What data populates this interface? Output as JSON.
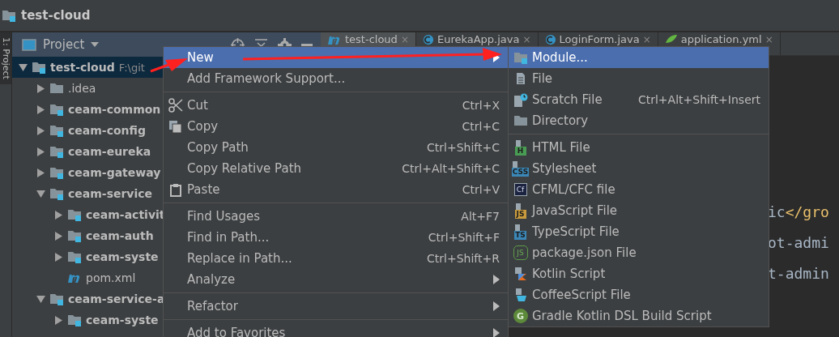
{
  "title": "test-cloud",
  "tool_window_tab": "1: Project",
  "project_panel": {
    "title": "Project"
  },
  "tree": [
    {
      "label": "test-cloud",
      "path": "F:\\git",
      "kind": "module",
      "expanded": true,
      "selected": true,
      "children": [
        {
          "label": ".idea",
          "kind": "folder",
          "expanded": false,
          "selected": false
        },
        {
          "label": "ceam-common",
          "kind": "module",
          "expanded": false,
          "selected": false
        },
        {
          "label": "ceam-config",
          "kind": "module",
          "expanded": false,
          "selected": false
        },
        {
          "label": "ceam-eureka",
          "kind": "module",
          "expanded": false,
          "selected": false
        },
        {
          "label": "ceam-gateway",
          "kind": "module",
          "expanded": false,
          "selected": false
        },
        {
          "label": "ceam-service",
          "kind": "module",
          "expanded": true,
          "selected": false,
          "children": [
            {
              "label": "ceam-activit",
              "kind": "module",
              "expanded": false,
              "selected": false
            },
            {
              "label": "ceam-auth",
              "kind": "module",
              "expanded": false,
              "selected": false
            },
            {
              "label": "ceam-syste",
              "kind": "module",
              "expanded": false,
              "selected": false
            },
            {
              "label": "pom.xml",
              "kind": "maven",
              "selected": false
            }
          ]
        },
        {
          "label": "ceam-service-a",
          "kind": "module",
          "expanded": true,
          "selected": false,
          "children": [
            {
              "label": "ceam-syste",
              "kind": "module",
              "expanded": false,
              "selected": false
            }
          ]
        }
      ]
    }
  ],
  "editor_tabs": [
    {
      "label": "test-cloud",
      "close": "×",
      "kind": "maven",
      "selected": true
    },
    {
      "label": "EurekaApp.java",
      "close": "×",
      "kind": "java",
      "selected": false
    },
    {
      "label": "LoginForm.java",
      "close": "×",
      "kind": "java",
      "selected": false
    },
    {
      "label": "application.yml",
      "close": "×",
      "kind": "yaml",
      "selected": false
    }
  ],
  "code_lines": [
    [
      {
        "text": "ic",
        "kind": "text"
      },
      {
        "text": "</gro",
        "kind": "tag"
      }
    ],
    [
      {
        "text": "ot-admi",
        "kind": "text"
      }
    ],
    [
      {
        "text": "t-admin",
        "kind": "text"
      }
    ]
  ],
  "context_menu": {
    "items": [
      {
        "kind": "plain",
        "label": "New",
        "selected": true,
        "submenu": true
      },
      {
        "kind": "plain",
        "label": "Add Framework Support...",
        "selected": false
      },
      {
        "kind": "separator"
      },
      {
        "kind": "scissors",
        "label": "Cut",
        "shortcut": "Ctrl+X",
        "selected": false
      },
      {
        "kind": "copy",
        "label": "Copy",
        "shortcut": "Ctrl+C",
        "selected": false
      },
      {
        "kind": "plain",
        "label": "Copy Path",
        "shortcut": "Ctrl+Shift+C",
        "selected": false
      },
      {
        "kind": "plain",
        "label": "Copy Relative Path",
        "shortcut": "Ctrl+Alt+Shift+C",
        "selected": false
      },
      {
        "kind": "clipboard",
        "label": "Paste",
        "shortcut": "Ctrl+V",
        "selected": false
      },
      {
        "kind": "separator"
      },
      {
        "kind": "plain",
        "label": "Find Usages",
        "shortcut": "Alt+F7",
        "selected": false
      },
      {
        "kind": "plain",
        "label": "Find in Path...",
        "shortcut": "Ctrl+Shift+F",
        "selected": false
      },
      {
        "kind": "plain",
        "label": "Replace in Path...",
        "shortcut": "Ctrl+Shift+R",
        "selected": false
      },
      {
        "kind": "plain",
        "label": "Analyze",
        "selected": false,
        "submenu": true
      },
      {
        "kind": "separator"
      },
      {
        "kind": "plain",
        "label": "Refactor",
        "selected": false,
        "submenu": true
      },
      {
        "kind": "separator"
      },
      {
        "kind": "plain",
        "label": "Add to Favorites",
        "selected": false,
        "submenu": true
      }
    ]
  },
  "submenu": {
    "items": [
      {
        "kind": "module",
        "label": "Module...",
        "selected": true
      },
      {
        "kind": "file",
        "label": "File",
        "selected": false
      },
      {
        "kind": "scratch",
        "label": "Scratch File",
        "shortcut": "Ctrl+Alt+Shift+Insert",
        "selected": false
      },
      {
        "kind": "folder",
        "label": "Directory",
        "selected": false
      },
      {
        "kind": "separator"
      },
      {
        "kind": "badge",
        "badge": "H",
        "color": "#499c54",
        "label": "HTML File",
        "selected": false
      },
      {
        "kind": "badge",
        "badge": "CSS",
        "color": "#3a87b8",
        "label": "Stylesheet",
        "selected": false
      },
      {
        "kind": "square",
        "badge": "Cf",
        "label": "CFML/CFC file",
        "selected": false
      },
      {
        "kind": "badge",
        "badge": "JS",
        "color": "#c99b3d",
        "label": "JavaScript File",
        "selected": false
      },
      {
        "kind": "badge",
        "badge": "TS",
        "color": "#3a87b8",
        "label": "TypeScript File",
        "selected": false
      },
      {
        "kind": "hexagon",
        "badge": "JS",
        "label": "package.json File",
        "selected": false
      },
      {
        "kind": "kotlin",
        "label": "Kotlin Script",
        "selected": false
      },
      {
        "kind": "coffee",
        "label": "CoffeeScript File",
        "selected": false
      },
      {
        "kind": "circle",
        "badge": "G",
        "label": "Gradle Kotlin DSL Build Script",
        "selected": false
      }
    ]
  }
}
